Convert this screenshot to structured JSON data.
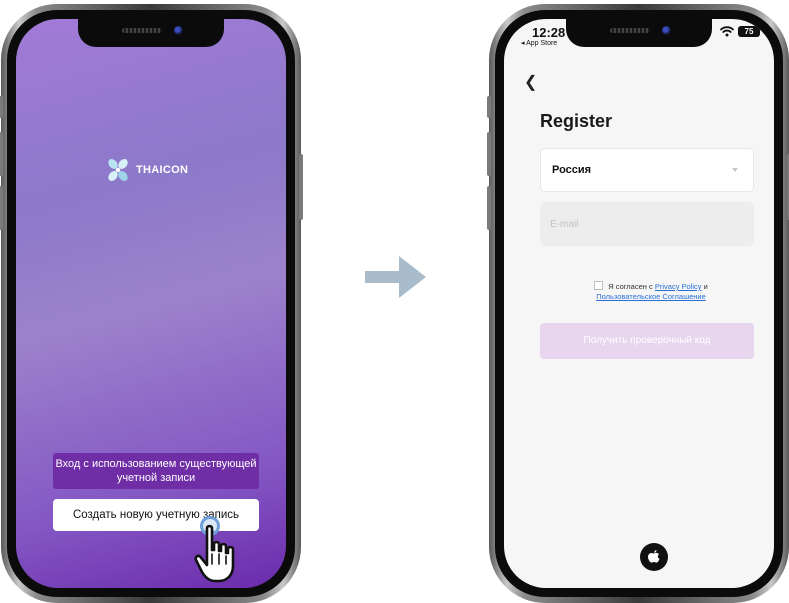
{
  "welcome_screen": {
    "brand": "THAICON",
    "existing_account_label": "Вход с использованием существующей учетной записи",
    "create_account_label": "Создать новую учетную запись"
  },
  "register_screen": {
    "status_time": "12:28",
    "status_back_app": "◂ App Store",
    "battery": "75",
    "title": "Register",
    "country": "Россия",
    "email_placeholder": "E-mail",
    "agree_prefix": "Я согласен с",
    "privacy_link": "Privacy Policy",
    "agree_and": "и",
    "terms_link": "Пользовательское Соглашение",
    "get_code_label": "Получить проверочный код"
  },
  "colors": {
    "purple_accent": "#6f2da6",
    "get_code_disabled": "#e8d6ef",
    "link_blue": "#2a6fd6",
    "arrow": "#a8bccb"
  },
  "icons": [
    "back-chevron-icon",
    "dropdown-caret-icon",
    "apple-icon",
    "wifi-icon",
    "battery-icon",
    "hand-pointer-icon",
    "arrow-right-icon"
  ]
}
